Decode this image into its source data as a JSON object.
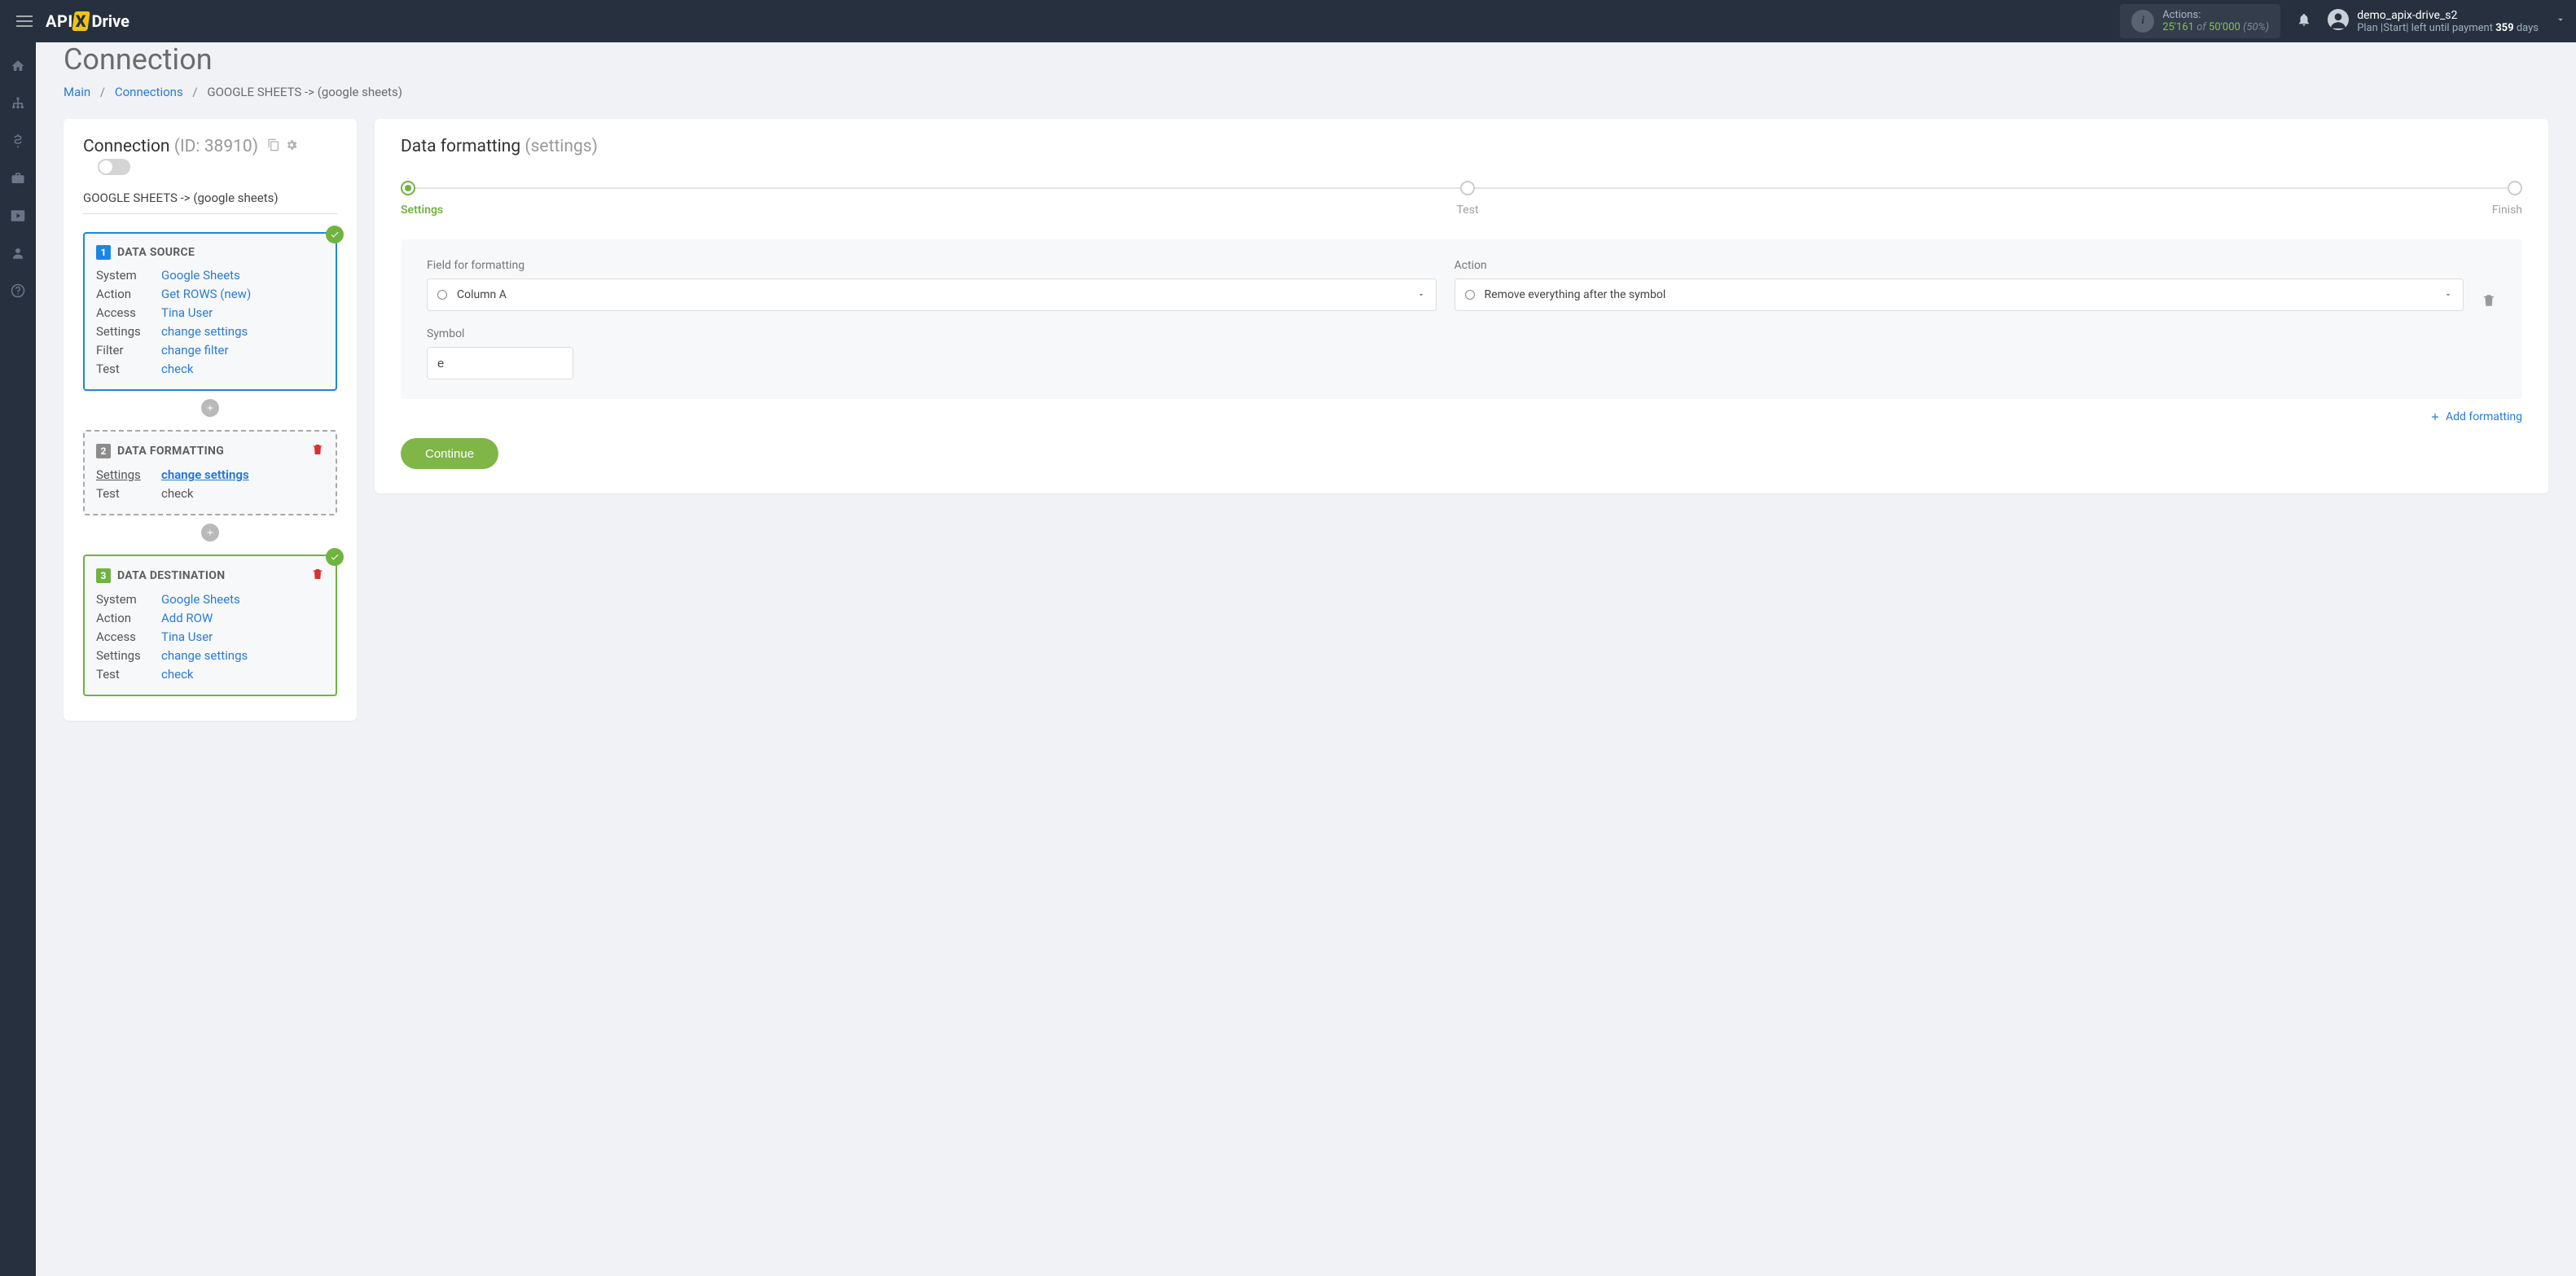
{
  "header": {
    "logo_api": "API",
    "logo_x": "X",
    "logo_drive": "Drive",
    "actions_label": "Actions:",
    "actions_used": "25'161",
    "actions_of": "of",
    "actions_total": "50'000",
    "actions_pct": "(50%)",
    "username": "demo_apix-drive_s2",
    "plan_prefix": "Plan |Start| left until payment",
    "plan_days": "359",
    "plan_suffix": "days"
  },
  "page": {
    "title": "Connection",
    "breadcrumb_main": "Main",
    "breadcrumb_connections": "Connections",
    "breadcrumb_current": "GOOGLE SHEETS -> (google sheets)"
  },
  "left": {
    "conn_label": "Connection",
    "conn_id": "(ID: 38910)",
    "conn_name": "GOOGLE SHEETS -> (google sheets)",
    "step1": {
      "num": "1",
      "title": "DATA SOURCE",
      "system_k": "System",
      "system_v": "Google Sheets",
      "action_k": "Action",
      "action_v": "Get ROWS (new)",
      "access_k": "Access",
      "access_v": "Tina User",
      "settings_k": "Settings",
      "settings_v": "change settings",
      "filter_k": "Filter",
      "filter_v": "change filter",
      "test_k": "Test",
      "test_v": "check"
    },
    "step2": {
      "num": "2",
      "title": "DATA FORMATTING",
      "settings_k": "Settings",
      "settings_v": "change settings",
      "test_k": "Test",
      "test_v": "check"
    },
    "step3": {
      "num": "3",
      "title": "DATA DESTINATION",
      "system_k": "System",
      "system_v": "Google Sheets",
      "action_k": "Action",
      "action_v": "Add ROW",
      "access_k": "Access",
      "access_v": "Tina User",
      "settings_k": "Settings",
      "settings_v": "change settings",
      "test_k": "Test",
      "test_v": "check"
    }
  },
  "right": {
    "title_main": "Data formatting",
    "title_sub": "(settings)",
    "stepper_settings": "Settings",
    "stepper_test": "Test",
    "stepper_finish": "Finish",
    "field_label": "Field for formatting",
    "field_value": "Column A",
    "action_label": "Action",
    "action_value": "Remove everything after the symbol",
    "symbol_label": "Symbol",
    "symbol_value": "e",
    "add_formatting": "Add formatting",
    "continue": "Continue"
  }
}
